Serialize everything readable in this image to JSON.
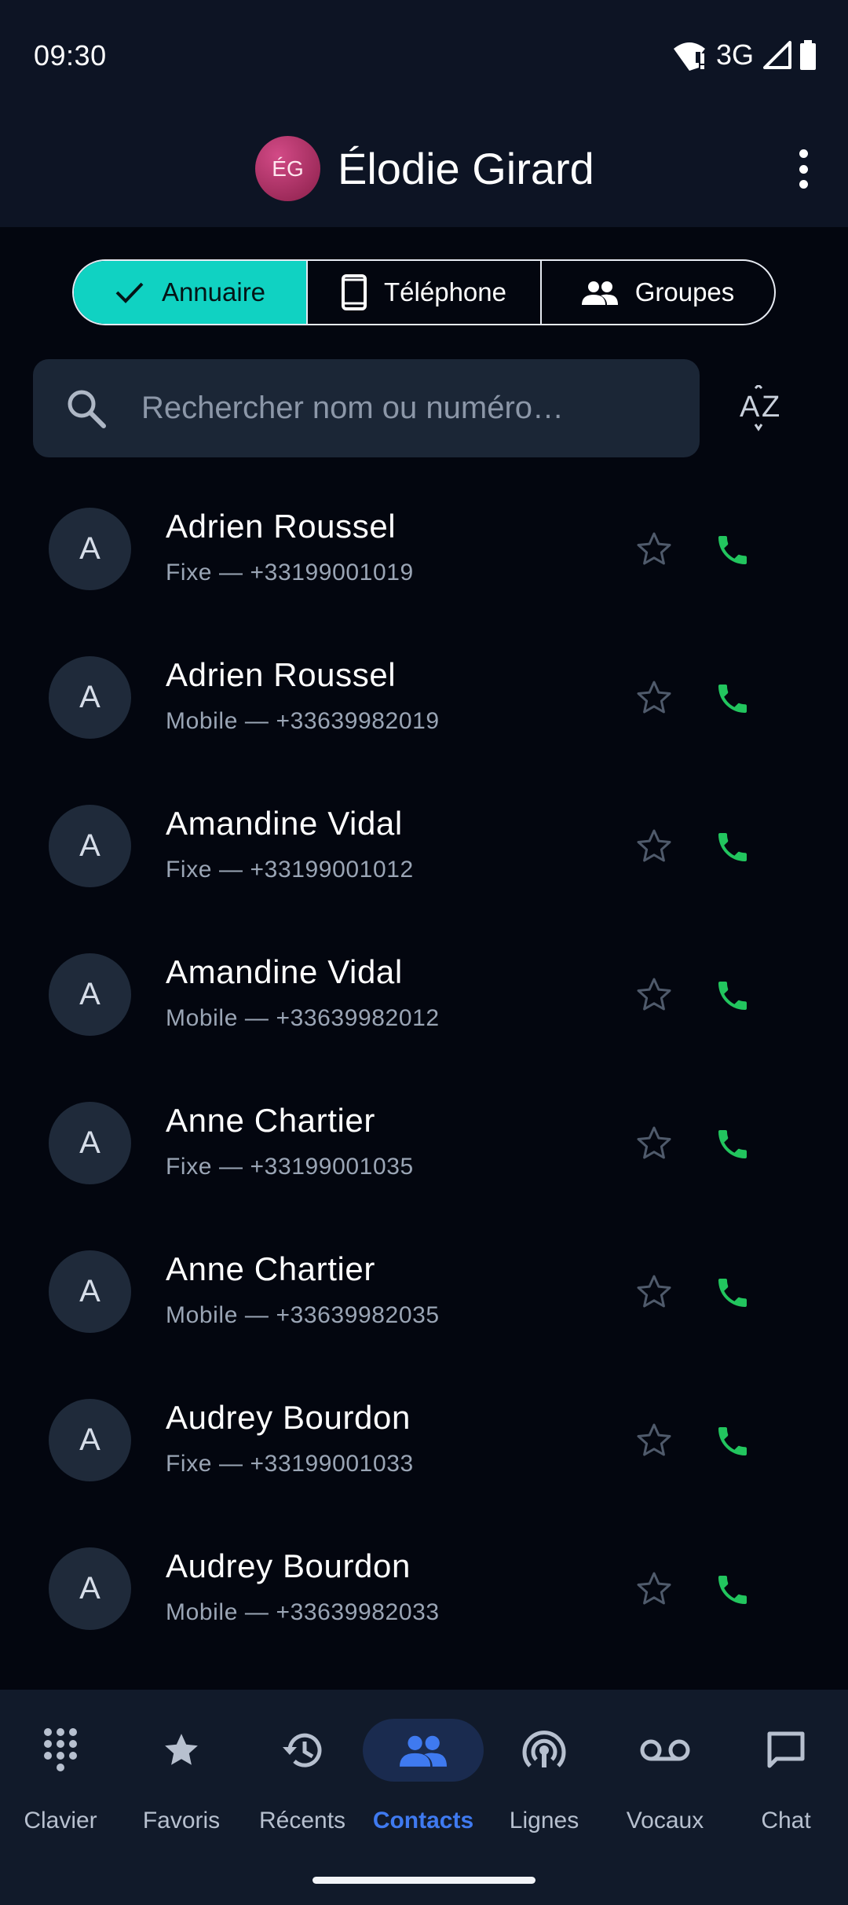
{
  "status_bar": {
    "time": "09:30",
    "network": "3G"
  },
  "header": {
    "initials": "ÉG",
    "name": "Élodie Girard"
  },
  "tabs": [
    {
      "label": "Annuaire",
      "icon": "check-icon",
      "active": true
    },
    {
      "label": "Téléphone",
      "icon": "smartphone-icon",
      "active": false
    },
    {
      "label": "Groupes",
      "icon": "people-icon",
      "active": false
    }
  ],
  "search": {
    "placeholder": "Rechercher nom ou numéro…"
  },
  "sort": {
    "icon": "sort-az-icon"
  },
  "contacts": [
    {
      "initial": "A",
      "name": "Adrien Roussel",
      "detail": "Fixe — +33199001019"
    },
    {
      "initial": "A",
      "name": "Adrien Roussel",
      "detail": "Mobile — +33639982019"
    },
    {
      "initial": "A",
      "name": "Amandine Vidal",
      "detail": "Fixe — +33199001012"
    },
    {
      "initial": "A",
      "name": "Amandine Vidal",
      "detail": "Mobile — +33639982012"
    },
    {
      "initial": "A",
      "name": "Anne Chartier",
      "detail": "Fixe — +33199001035"
    },
    {
      "initial": "A",
      "name": "Anne Chartier",
      "detail": "Mobile — +33639982035"
    },
    {
      "initial": "A",
      "name": "Audrey Bourdon",
      "detail": "Fixe — +33199001033"
    },
    {
      "initial": "A",
      "name": "Audrey Bourdon",
      "detail": "Mobile — +33639982033"
    }
  ],
  "bottom_nav": [
    {
      "label": "Clavier",
      "icon": "dialpad-icon",
      "active": false
    },
    {
      "label": "Favoris",
      "icon": "star-icon",
      "active": false
    },
    {
      "label": "Récents",
      "icon": "history-icon",
      "active": false
    },
    {
      "label": "Contacts",
      "icon": "contacts-icon",
      "active": true
    },
    {
      "label": "Lignes",
      "icon": "broadcast-icon",
      "active": false
    },
    {
      "label": "Vocaux",
      "icon": "voicemail-icon",
      "active": false
    },
    {
      "label": "Chat",
      "icon": "chat-icon",
      "active": false
    }
  ],
  "colors": {
    "accent_tab": "#10d2c2",
    "call_green": "#22c55e",
    "nav_active": "#3f7af0",
    "background": "#03060f"
  }
}
